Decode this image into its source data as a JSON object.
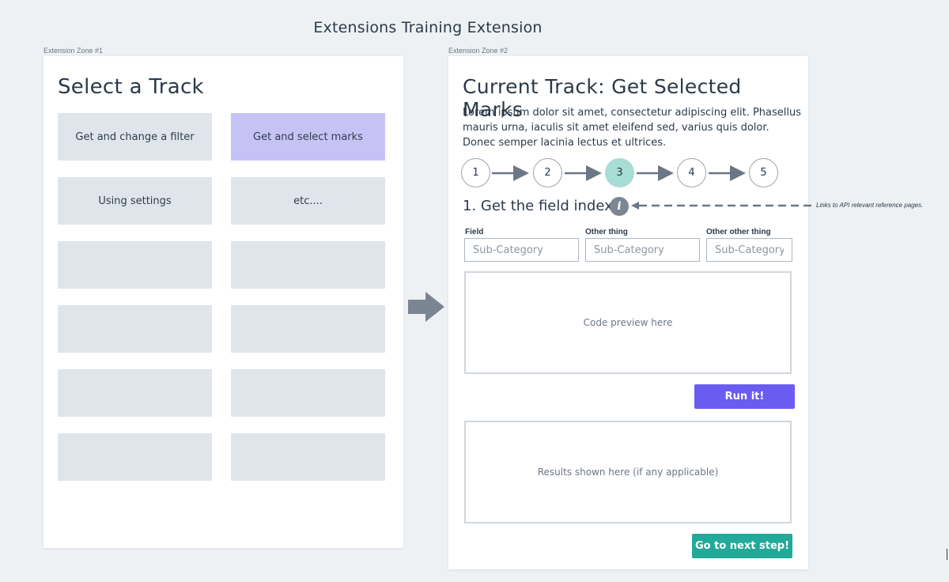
{
  "page": {
    "title": "Extensions Training Extension"
  },
  "zone1": {
    "label": "Extension Zone #1",
    "heading": "Select a Track",
    "tiles": [
      {
        "label": "Get and change a filter",
        "selected": false
      },
      {
        "label": "Get and select marks",
        "selected": true
      },
      {
        "label": "Using settings",
        "selected": false
      },
      {
        "label": "etc....",
        "selected": false
      },
      {
        "label": "",
        "selected": false
      },
      {
        "label": "",
        "selected": false
      },
      {
        "label": "",
        "selected": false
      },
      {
        "label": "",
        "selected": false
      },
      {
        "label": "",
        "selected": false
      },
      {
        "label": "",
        "selected": false
      },
      {
        "label": "",
        "selected": false
      },
      {
        "label": "",
        "selected": false
      }
    ]
  },
  "zone2": {
    "label": "Extension Zone #2",
    "heading": "Current Track: Get Selected Marks",
    "description": "Lorem ipsum dolor sit amet, consectetur adipiscing elit. Phasellus mauris urna, iaculis sit amet eleifend sed, varius quis dolor. Donec semper lacinia lectus et ultrices.",
    "steps": [
      "1",
      "2",
      "3",
      "4",
      "5"
    ],
    "active_step": 3,
    "step_title": "1. Get the field index",
    "info_icon": "info-icon",
    "fields": [
      {
        "label": "Field",
        "placeholder": "Sub-Category"
      },
      {
        "label": "Other thing",
        "placeholder": "Sub-Category"
      },
      {
        "label": "Other other thing",
        "placeholder": "Sub-Category"
      }
    ],
    "code_preview": "Code preview here",
    "run_button": "Run it!",
    "results": "Results shown here (if any applicable)",
    "next_button": "Go to next step!"
  },
  "annotation": "Links to API relevant reference pages.",
  "colors": {
    "background": "#eef1f4",
    "tile": "#dfe5eb",
    "tile_selected": "#c7c2f6",
    "step_active": "#a7ddd5",
    "run_button": "#6a5cf1",
    "next_button": "#22a99a",
    "arrow": "#7b8591"
  }
}
